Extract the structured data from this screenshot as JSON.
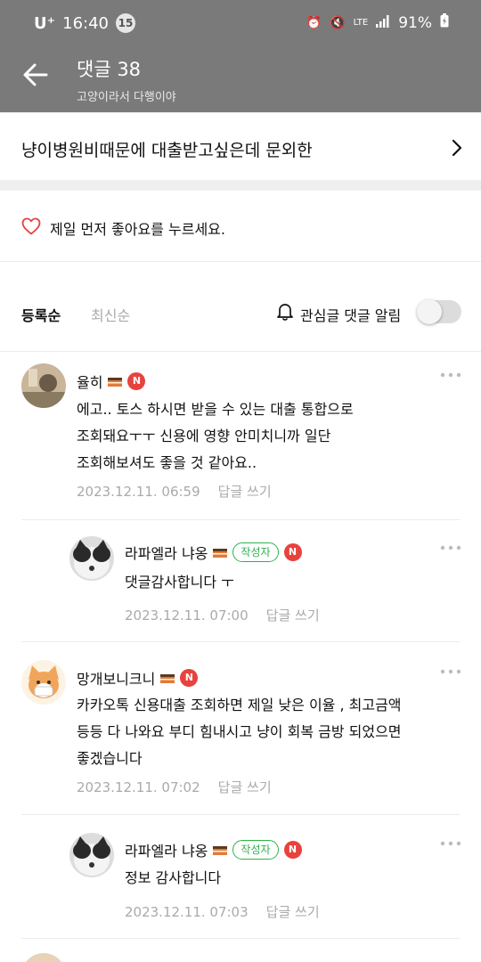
{
  "status_bar": {
    "carrier": "U⁺",
    "time": "16:40",
    "notif_count": "15",
    "network": "LTE",
    "battery": "91%"
  },
  "header": {
    "title": "댓글 38",
    "subtitle": "고양이라서 다행이야"
  },
  "post": {
    "title": "냥이병원비때문에 대출받고싶은데 문외한"
  },
  "like": {
    "text": "제일 먼저 좋아요를 누르세요."
  },
  "sort": {
    "option_a": "등록순",
    "option_b": "최신순",
    "notify_label": "관심글 댓글 알림"
  },
  "common": {
    "reply_label": "답글 쓰기",
    "author_badge": "작성자",
    "n_badge": "N"
  },
  "comments": [
    {
      "name": "율히",
      "lines": [
        "에고.. 토스 하시면 받을 수 있는 대출 통합으로",
        "조회돼요ㅜㅜ 신용에 영향 안미치니까 일단",
        "조회해보셔도 좋을 것 같아요.."
      ],
      "date": "2023.12.11. 06:59"
    },
    {
      "name": "라파엘라 냐옹",
      "lines": [
        "댓글감사합니다 ㅜ"
      ],
      "date": "2023.12.11. 07:00"
    },
    {
      "name": "망개보니크니",
      "lines": [
        "카카오톡 신용대출 조회하면 제일 낮은 이율 , 최고금액",
        "등등 다 나와요 부디 힘내시고 냥이 회복 금방 되었으면",
        "좋겠습니다"
      ],
      "date": "2023.12.11. 07:02"
    },
    {
      "name": "라파엘라 냐옹",
      "lines": [
        "정보 감사합니다"
      ],
      "date": "2023.12.11. 07:03"
    }
  ]
}
